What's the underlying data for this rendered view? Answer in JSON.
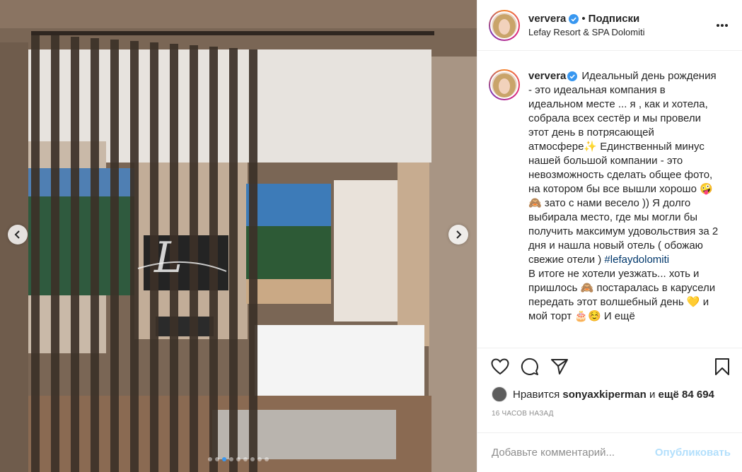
{
  "post": {
    "username": "ververa",
    "separator": "•",
    "follow_label": "Подписки",
    "location": "Lefay Resort & SPA Dolomiti"
  },
  "caption": {
    "username": "ververa",
    "text_before_tag": "Идеальный день рождения - это идеальная компания в идеальном месте ... я , как и хотела, собрала всех сестёр и мы провели этот день в потрясающей атмосфере✨ Единственный минус нашей большой компании - это невозможность сделать общее фото, на котором бы все вышли хорошо 🤪🙈 зато с нами весело )) Я долго выбирала место, где мы могли бы получить максимум удовольствия за 2 дня и нашла новый отель ( обожаю свежие отели )",
    "hashtag": "#lefaydolomiti",
    "text_after_tag": "В итоге не хотели уезжать... хоть и пришлось 🙈 постаралась в карусели передать этот волшебный день 💛 и мой торт 🎂☺️ И ещё",
    "verified_icon": "verified-badge-icon"
  },
  "likes": {
    "prefix": "Нравится",
    "liker": "sonyaxkiperman",
    "connector": "и",
    "count": "ещё 84 694"
  },
  "timestamp": "16 ЧАСОВ НАЗАД",
  "comment": {
    "placeholder": "Добавьте комментарий...",
    "publish_label": "Опубликовать"
  },
  "carousel": {
    "slide_count": 9,
    "active_index": 2
  },
  "colors": {
    "verified": "#3897f0",
    "link": "#00376b",
    "publish_disabled": "#b2dffc",
    "muted": "#8e8e8e"
  }
}
